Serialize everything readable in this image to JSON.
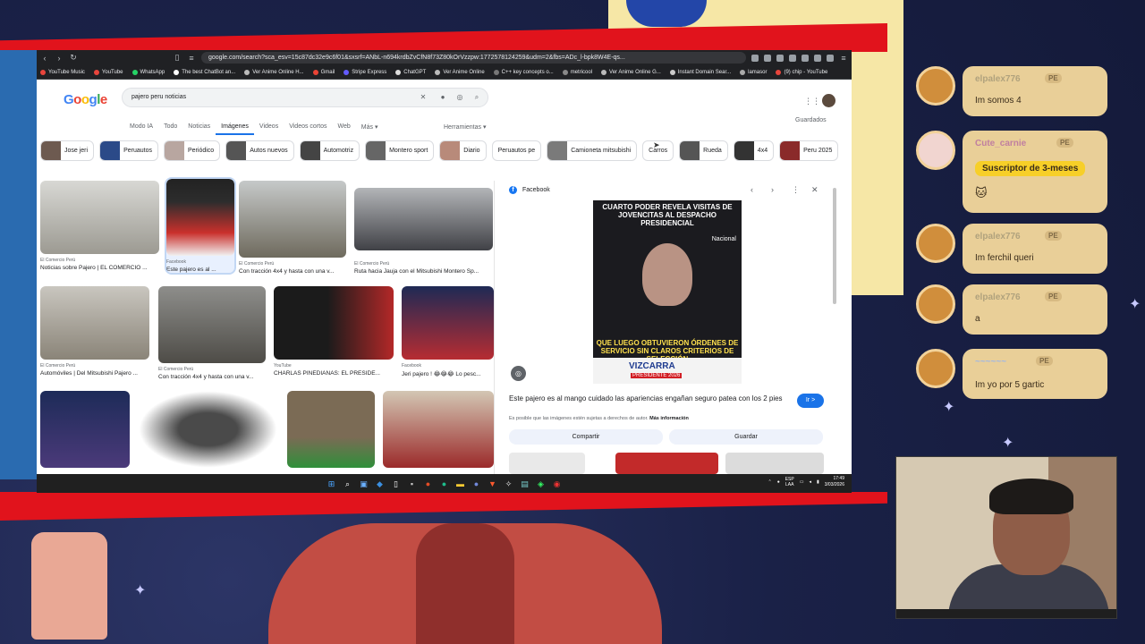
{
  "browser": {
    "url": "google.com/search?sca_esv=15c87dc32e9c6f01&sxsrf=ANbL-n694krdbZvCfN8f73Z80kOrVzzpw:1772578124259&udm=2&fbs=ADc_l-bpk8W4E-qs...",
    "bookmarks": [
      "YouTube Music",
      "YouTube",
      "WhatsApp",
      "The best ChatBot an...",
      "Ver Anime Online H...",
      "Gmail",
      "Stripe Express",
      "ChatGPT",
      "Ver Anime Online",
      "C++ key concepts o...",
      "metricool",
      "Ver Anime Online G...",
      "Instant Domain Sear...",
      "lamasor",
      "(9) chip - YouTube"
    ]
  },
  "google": {
    "query": "pajero peru noticias",
    "tabs": [
      "Modo IA",
      "Todo",
      "Noticias",
      "Imágenes",
      "Videos",
      "Videos cortos",
      "Web",
      "Más ▾"
    ],
    "tools_label": "Herramientas ▾",
    "saved_label": "Guardados",
    "chips": [
      "Jose jeri",
      "Peruautos",
      "Periódico",
      "Autos nuevos",
      "Automotriz",
      "Montero sport",
      "Diario",
      "Peruautos pe",
      "Camioneta mitsubishi",
      "Carros",
      "Rueda",
      "4x4",
      "Peru 2025"
    ]
  },
  "results": [
    {
      "src": "El Comercio Perú",
      "cap": "Noticias sobre Pajero | EL COMERCIO ..."
    },
    {
      "src": "Facebook",
      "cap": "Este pajero es al ..."
    },
    {
      "src": "El Comercio Perú",
      "cap": "Con tracción 4x4 y hasta con una v..."
    },
    {
      "src": "El Comercio Perú",
      "cap": "Ruta hacia Jauja con el Mitsubishi Montero Sp..."
    },
    {
      "src": "El Comercio Perú",
      "cap": "Automóviles | Del Mitsubishi Pajero ..."
    },
    {
      "src": "El Comercio Perú",
      "cap": "Con tracción 4x4 y hasta con una v..."
    },
    {
      "src": "YouTube",
      "cap": "CHARLAS PINEDIANAS: EL PRESIDE..."
    },
    {
      "src": "Facebook",
      "cap": "Jeri pajero ! 😂😂😂 Lo pesc..."
    }
  ],
  "preview": {
    "source": "Facebook",
    "headline_top": "CUARTO PODER REVELA VISITAS DE JOVENCITAS AL DESPACHO PRESIDENCIAL",
    "headline_bottom": "QUE LUEGO OBTUVIERON ÓRDENES DE SERVICIO SIN CLAROS CRITERIOS DE SELECCIÓN",
    "logo_text": "Nacional",
    "poster_name": "VIZCARRA",
    "poster_sub": "PRESIDENTE 2026",
    "title": "Este pajero es al mango cuidado las apariencias engañan seguro patea con los 2 pies",
    "ir_label": "Ir >",
    "note": "Es posible que las imágenes estén sujetas a derechos de autor.",
    "note_link": "Más información",
    "share_label": "Compartir",
    "save_label": "Guardar"
  },
  "taskbar": {
    "lang": "ESP",
    "lang2": "LAA",
    "time": "17:49",
    "date": "3/03/2026"
  },
  "chat": [
    {
      "user": "elpalex776",
      "badge": "PE",
      "text": "Im somos 4"
    },
    {
      "user": "Cute_carnie",
      "badge": "PE",
      "sub": "Suscriptor de 3-meses",
      "text": ""
    },
    {
      "user": "elpalex776",
      "badge": "PE",
      "text": "Im ferchil queri"
    },
    {
      "user": "elpalex776",
      "badge": "PE",
      "text": "a"
    },
    {
      "user": "",
      "badge": "PE",
      "text": "Im yo por 5 gartic"
    }
  ]
}
